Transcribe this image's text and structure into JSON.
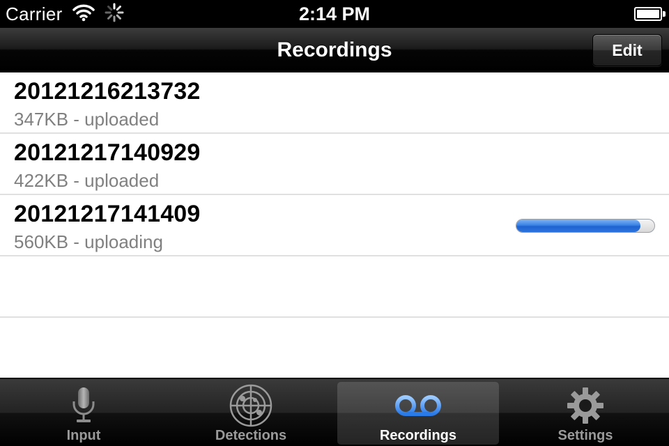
{
  "status_bar": {
    "carrier": "Carrier",
    "time": "2:14 PM",
    "icons": [
      "wifi-icon",
      "activity-spinner-icon",
      "battery-icon"
    ]
  },
  "nav_bar": {
    "title": "Recordings",
    "edit_label": "Edit"
  },
  "recordings": [
    {
      "name": "20121216213732",
      "detail": "347KB - uploaded"
    },
    {
      "name": "20121217140929",
      "detail": "422KB - uploaded"
    },
    {
      "name": "20121217141409",
      "detail": "560KB - uploading",
      "upload_progress": 0.9
    }
  ],
  "tab_bar": {
    "tabs": [
      {
        "label": "Input",
        "icon": "microphone-icon"
      },
      {
        "label": "Detections",
        "icon": "radar-icon"
      },
      {
        "label": "Recordings",
        "icon": "voicemail-icon",
        "selected": true
      },
      {
        "label": "Settings",
        "icon": "gear-icon"
      }
    ]
  },
  "colors": {
    "accent_blue": "#3b82e6",
    "secondary_text": "#808080",
    "bar_black": "#000000"
  }
}
